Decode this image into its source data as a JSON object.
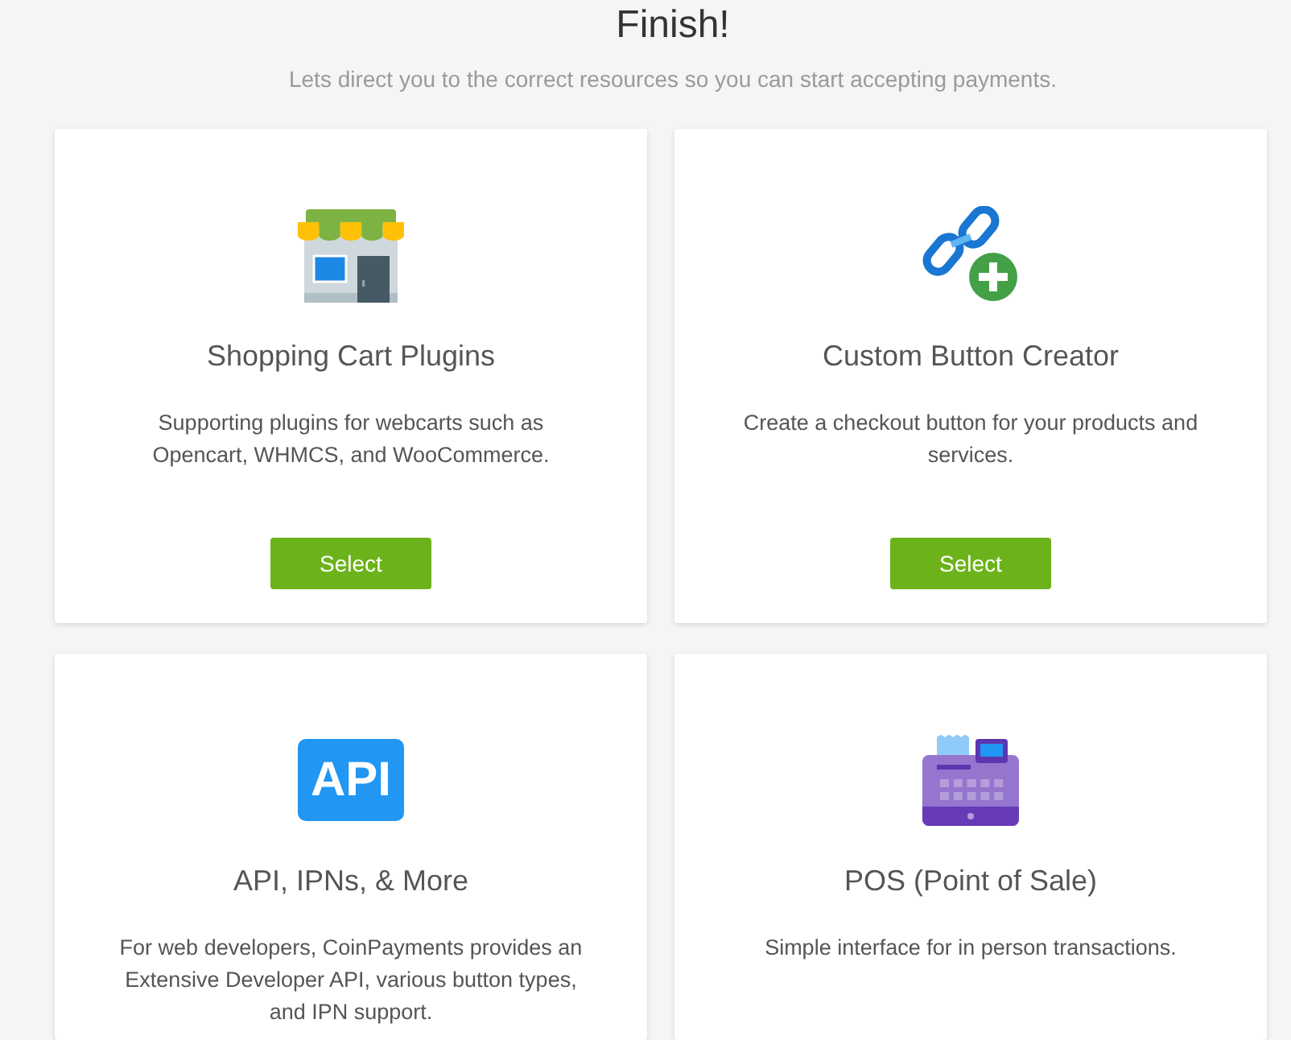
{
  "header": {
    "title": "Finish!",
    "subtitle": "Lets direct you to the correct resources so you can start accepting payments."
  },
  "cards": [
    {
      "kind": "store",
      "title": "Shopping Cart Plugins",
      "description": "Supporting plugins for webcarts such as Opencart, WHMCS, and WooCommerce.",
      "button": "Select"
    },
    {
      "kind": "link",
      "title": "Custom Button Creator",
      "description": "Create a checkout button for your products and services.",
      "button": "Select"
    },
    {
      "kind": "api",
      "icon_label": "API",
      "title": "API, IPNs, & More",
      "description": "For web developers, CoinPayments provides an Extensive Developer API, various button types, and IPN support."
    },
    {
      "kind": "register",
      "title": "POS (Point of Sale)",
      "description": "Simple interface for in person transactions."
    }
  ]
}
